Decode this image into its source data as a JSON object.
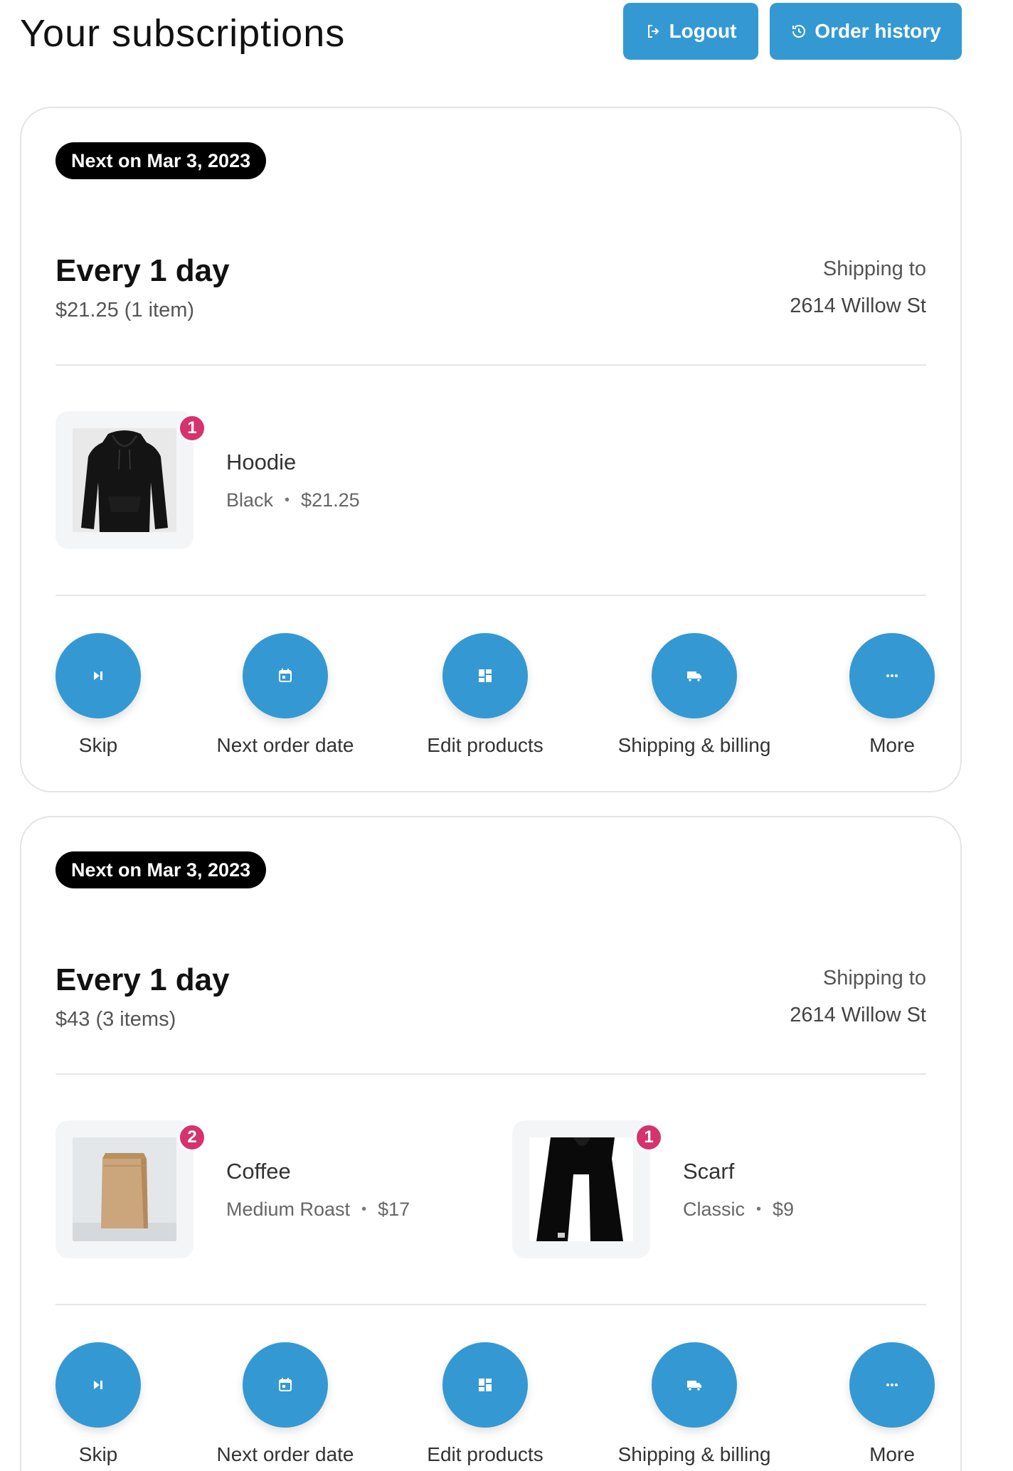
{
  "header": {
    "title": "Your subscriptions",
    "logout_label": "Logout",
    "order_history_label": "Order history"
  },
  "colors": {
    "primary": "#3499d2",
    "badge": "#d6336c",
    "next_badge_bg": "#000000"
  },
  "subscriptions": [
    {
      "next_label": "Next on Mar 3, 2023",
      "frequency": "Every 1 day",
      "summary": "$21.25 (1 item)",
      "shipping_label": "Shipping to",
      "shipping_address": "2614 Willow St",
      "products": [
        {
          "name": "Hoodie",
          "variant": "Black",
          "price": "$21.25",
          "quantity": "1",
          "image": "hoodie-image"
        }
      ]
    },
    {
      "next_label": "Next on Mar 3, 2023",
      "frequency": "Every 1 day",
      "summary": "$43 (3 items)",
      "shipping_label": "Shipping to",
      "shipping_address": "2614 Willow St",
      "products": [
        {
          "name": "Coffee",
          "variant": "Medium Roast",
          "price": "$17",
          "quantity": "2",
          "image": "coffee-bag-image"
        },
        {
          "name": "Scarf",
          "variant": "Classic",
          "price": "$9",
          "quantity": "1",
          "image": "scarf-image"
        }
      ]
    }
  ],
  "actions": [
    {
      "label": "Skip",
      "icon": "skip-icon"
    },
    {
      "label": "Next order date",
      "icon": "calendar-icon"
    },
    {
      "label": "Edit products",
      "icon": "dashboard-icon"
    },
    {
      "label": "Shipping & billing",
      "icon": "truck-icon"
    },
    {
      "label": "More",
      "icon": "more-icon"
    }
  ]
}
